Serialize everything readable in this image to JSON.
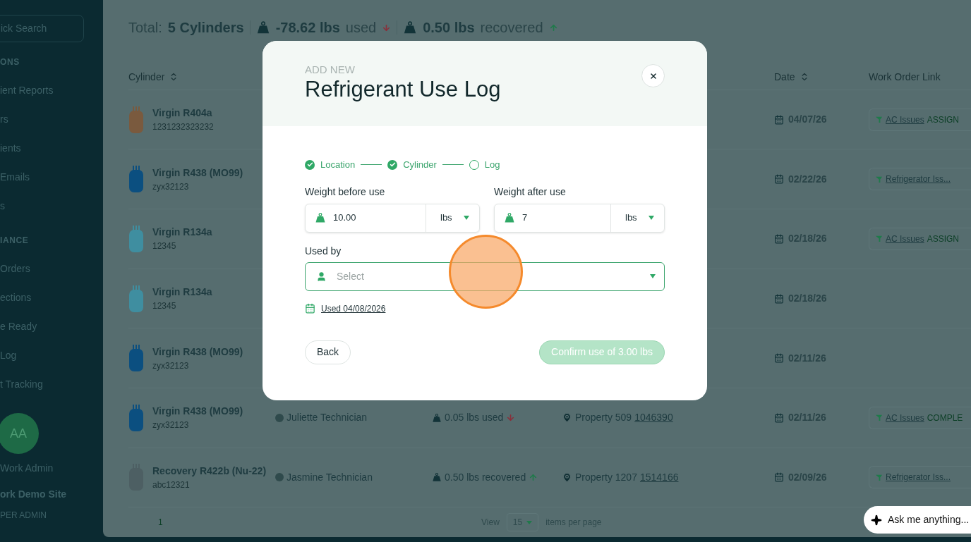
{
  "sidebar": {
    "search_placeholder": "ick Search",
    "sections": [
      {
        "title": "ONS",
        "items": [
          "ient Reports",
          "rs",
          "ients",
          "Emails",
          "s"
        ]
      },
      {
        "title": "IANCE",
        "items": [
          "Orders",
          "ections",
          "e Ready",
          "Log",
          "t Tracking"
        ]
      }
    ],
    "user": {
      "initials": "AA",
      "name": "Work Admin",
      "site": "ork Demo Site",
      "role": "PER ADMIN"
    }
  },
  "summary": {
    "label": "Total:",
    "count": "5 Cylinders",
    "items": [
      {
        "kind": "used",
        "amount": "-78.62 lbs",
        "word": "used"
      },
      {
        "kind": "recovered",
        "amount": "0.50 lbs",
        "word": "recovered"
      }
    ]
  },
  "table": {
    "columns": [
      {
        "label": "Cylinder",
        "sortable": true
      },
      {
        "label": "Date",
        "sortable": true
      },
      {
        "label": "Work Order Link",
        "sortable": false
      }
    ],
    "rows": [
      {
        "name": "Virgin R404a",
        "serial": "1231232323232",
        "color": "#7a5a3e",
        "date": "04/07/26",
        "work_order": {
          "link": "AC Issues",
          "status": "ASSIGN"
        }
      },
      {
        "name": "Virgin R438 (MO99)",
        "serial": "zyx32123",
        "color": "#0b4f80",
        "date": "02/22/26",
        "work_order": {
          "link": "Refrigerator Iss..."
        }
      },
      {
        "name": "Virgin R134a",
        "serial": "12345",
        "color": "#3f8ea0",
        "date": "02/18/26",
        "work_order": {
          "link": "AC Issues",
          "status": "ASSIGN"
        }
      },
      {
        "name": "Virgin R134a",
        "serial": "12345",
        "color": "#3f8ea0",
        "date": "02/18/26"
      },
      {
        "name": "Virgin R438 (MO99)",
        "serial": "zyx32123",
        "color": "#0b4f80",
        "date": "02/11/26"
      },
      {
        "name": "Virgin R438 (MO99)",
        "serial": "zyx32123",
        "color": "#0b4f80",
        "technician": "Juliette Technician",
        "amount": {
          "kind": "used",
          "text": "0.05 lbs used"
        },
        "property": {
          "name": "Property 509",
          "link": "1046390"
        },
        "date": "02/11/26",
        "work_order": {
          "link": "AC Issues",
          "status": "COMPLE"
        }
      },
      {
        "name": "Recovery R422b (Nu-22)",
        "serial": "abc12321",
        "color": "#4d5f63",
        "technician": "Jasmine Technician",
        "amount": {
          "kind": "recovered",
          "text": "0.50 lbs recovered"
        },
        "property": {
          "name": "Property 1207",
          "link": "1514166"
        },
        "date": "02/09/26",
        "work_order": {
          "link": "Refrigerator Iss..."
        }
      }
    ]
  },
  "pagination": {
    "page": "1",
    "view_label": "View",
    "per_page": "15",
    "per_page_label": "items per page"
  },
  "modal": {
    "eyebrow": "ADD NEW",
    "title": "Refrigerant Use Log",
    "steps": [
      {
        "label": "Location",
        "done": true
      },
      {
        "label": "Cylinder",
        "done": true
      },
      {
        "label": "Log",
        "done": false
      }
    ],
    "weights": [
      {
        "label": "Weight before use",
        "value": "10.00",
        "unit": "lbs"
      },
      {
        "label": "Weight after use",
        "value": "7",
        "unit": "lbs"
      }
    ],
    "used_by": {
      "label": "Used by",
      "placeholder": "Select"
    },
    "date_link": "Used 04/08/2026",
    "back": "Back",
    "confirm": {
      "label": "Confirm use of 3.00 lbs",
      "disabled": true
    }
  },
  "assistant": {
    "placeholder": "Ask me anything..."
  }
}
